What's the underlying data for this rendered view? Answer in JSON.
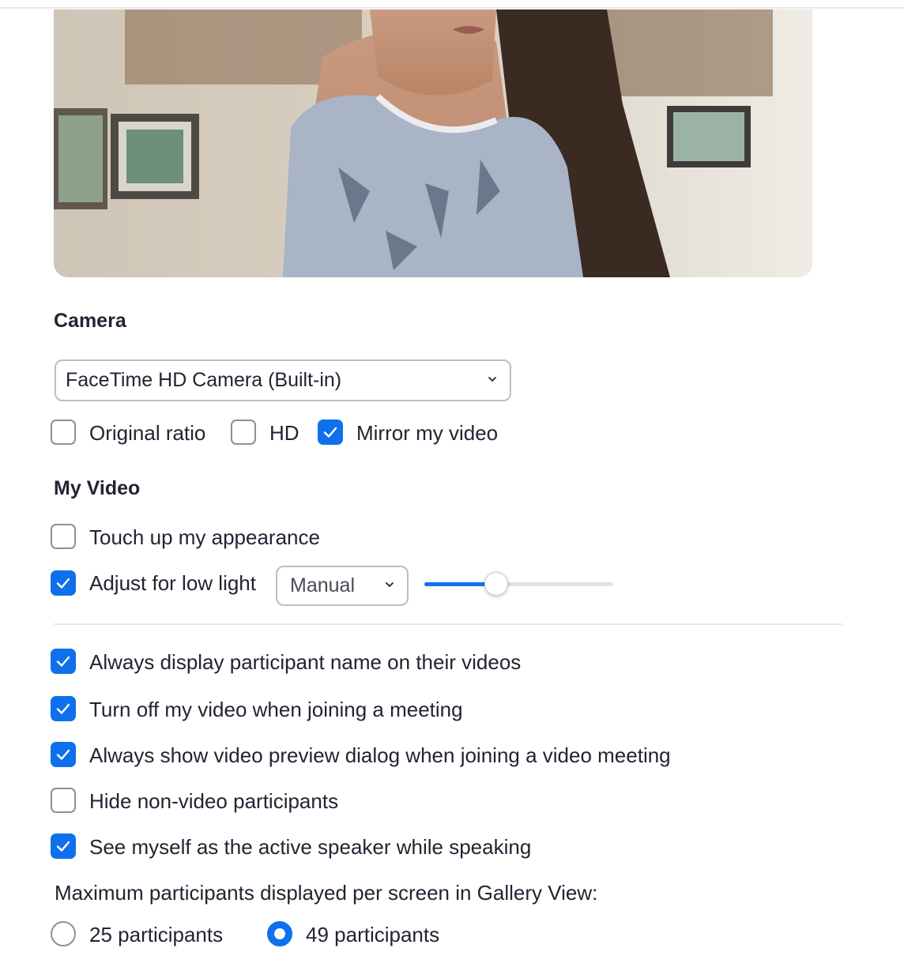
{
  "camera_section": {
    "title": "Camera",
    "device_select": {
      "value": "FaceTime HD Camera (Built-in)"
    },
    "options": [
      {
        "label": "Original ratio",
        "checked": false
      },
      {
        "label": "HD",
        "checked": false
      },
      {
        "label": "Mirror my video",
        "checked": true
      }
    ]
  },
  "my_video_section": {
    "title": "My Video",
    "touch_up": {
      "label": "Touch up my appearance",
      "checked": false
    },
    "low_light": {
      "label": "Adjust for low light",
      "checked": true,
      "mode_select": {
        "value": "Manual"
      },
      "slider_level": 0.38
    }
  },
  "general_options": [
    {
      "label": "Always display participant name on their videos",
      "checked": true
    },
    {
      "label": "Turn off my video when joining a meeting",
      "checked": true
    },
    {
      "label": "Always show video preview dialog when joining a video meeting",
      "checked": true
    },
    {
      "label": "Hide non-video participants",
      "checked": false
    },
    {
      "label": "See myself as the active speaker while speaking",
      "checked": true
    }
  ],
  "gallery": {
    "label": "Maximum participants displayed per screen in Gallery View:",
    "options": [
      {
        "label": "25 participants",
        "selected": false
      },
      {
        "label": "49 participants",
        "selected": true
      }
    ]
  },
  "colors": {
    "accent": "#0e71eb",
    "text": "#232333",
    "border": "#8e8e96"
  },
  "icons": {
    "check": "check-icon",
    "dropdown": "chevron-down-icon"
  }
}
